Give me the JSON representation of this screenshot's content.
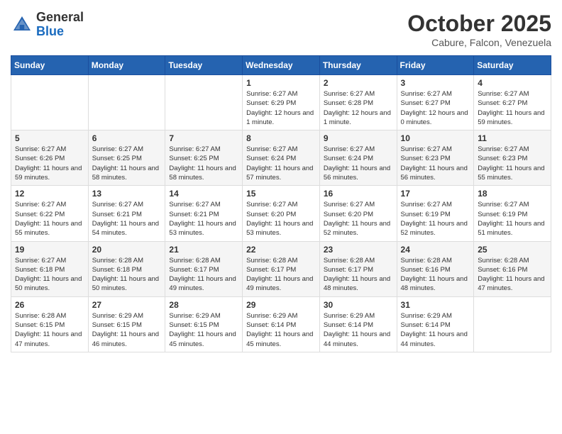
{
  "header": {
    "logo_general": "General",
    "logo_blue": "Blue",
    "month_title": "October 2025",
    "location": "Cabure, Falcon, Venezuela"
  },
  "days_of_week": [
    "Sunday",
    "Monday",
    "Tuesday",
    "Wednesday",
    "Thursday",
    "Friday",
    "Saturday"
  ],
  "weeks": [
    [
      {
        "day": "",
        "sunrise": "",
        "sunset": "",
        "daylight": ""
      },
      {
        "day": "",
        "sunrise": "",
        "sunset": "",
        "daylight": ""
      },
      {
        "day": "",
        "sunrise": "",
        "sunset": "",
        "daylight": ""
      },
      {
        "day": "1",
        "sunrise": "Sunrise: 6:27 AM",
        "sunset": "Sunset: 6:29 PM",
        "daylight": "Daylight: 12 hours and 1 minute."
      },
      {
        "day": "2",
        "sunrise": "Sunrise: 6:27 AM",
        "sunset": "Sunset: 6:28 PM",
        "daylight": "Daylight: 12 hours and 1 minute."
      },
      {
        "day": "3",
        "sunrise": "Sunrise: 6:27 AM",
        "sunset": "Sunset: 6:27 PM",
        "daylight": "Daylight: 12 hours and 0 minutes."
      },
      {
        "day": "4",
        "sunrise": "Sunrise: 6:27 AM",
        "sunset": "Sunset: 6:27 PM",
        "daylight": "Daylight: 11 hours and 59 minutes."
      }
    ],
    [
      {
        "day": "5",
        "sunrise": "Sunrise: 6:27 AM",
        "sunset": "Sunset: 6:26 PM",
        "daylight": "Daylight: 11 hours and 59 minutes."
      },
      {
        "day": "6",
        "sunrise": "Sunrise: 6:27 AM",
        "sunset": "Sunset: 6:25 PM",
        "daylight": "Daylight: 11 hours and 58 minutes."
      },
      {
        "day": "7",
        "sunrise": "Sunrise: 6:27 AM",
        "sunset": "Sunset: 6:25 PM",
        "daylight": "Daylight: 11 hours and 58 minutes."
      },
      {
        "day": "8",
        "sunrise": "Sunrise: 6:27 AM",
        "sunset": "Sunset: 6:24 PM",
        "daylight": "Daylight: 11 hours and 57 minutes."
      },
      {
        "day": "9",
        "sunrise": "Sunrise: 6:27 AM",
        "sunset": "Sunset: 6:24 PM",
        "daylight": "Daylight: 11 hours and 56 minutes."
      },
      {
        "day": "10",
        "sunrise": "Sunrise: 6:27 AM",
        "sunset": "Sunset: 6:23 PM",
        "daylight": "Daylight: 11 hours and 56 minutes."
      },
      {
        "day": "11",
        "sunrise": "Sunrise: 6:27 AM",
        "sunset": "Sunset: 6:23 PM",
        "daylight": "Daylight: 11 hours and 55 minutes."
      }
    ],
    [
      {
        "day": "12",
        "sunrise": "Sunrise: 6:27 AM",
        "sunset": "Sunset: 6:22 PM",
        "daylight": "Daylight: 11 hours and 55 minutes."
      },
      {
        "day": "13",
        "sunrise": "Sunrise: 6:27 AM",
        "sunset": "Sunset: 6:21 PM",
        "daylight": "Daylight: 11 hours and 54 minutes."
      },
      {
        "day": "14",
        "sunrise": "Sunrise: 6:27 AM",
        "sunset": "Sunset: 6:21 PM",
        "daylight": "Daylight: 11 hours and 53 minutes."
      },
      {
        "day": "15",
        "sunrise": "Sunrise: 6:27 AM",
        "sunset": "Sunset: 6:20 PM",
        "daylight": "Daylight: 11 hours and 53 minutes."
      },
      {
        "day": "16",
        "sunrise": "Sunrise: 6:27 AM",
        "sunset": "Sunset: 6:20 PM",
        "daylight": "Daylight: 11 hours and 52 minutes."
      },
      {
        "day": "17",
        "sunrise": "Sunrise: 6:27 AM",
        "sunset": "Sunset: 6:19 PM",
        "daylight": "Daylight: 11 hours and 52 minutes."
      },
      {
        "day": "18",
        "sunrise": "Sunrise: 6:27 AM",
        "sunset": "Sunset: 6:19 PM",
        "daylight": "Daylight: 11 hours and 51 minutes."
      }
    ],
    [
      {
        "day": "19",
        "sunrise": "Sunrise: 6:27 AM",
        "sunset": "Sunset: 6:18 PM",
        "daylight": "Daylight: 11 hours and 50 minutes."
      },
      {
        "day": "20",
        "sunrise": "Sunrise: 6:28 AM",
        "sunset": "Sunset: 6:18 PM",
        "daylight": "Daylight: 11 hours and 50 minutes."
      },
      {
        "day": "21",
        "sunrise": "Sunrise: 6:28 AM",
        "sunset": "Sunset: 6:17 PM",
        "daylight": "Daylight: 11 hours and 49 minutes."
      },
      {
        "day": "22",
        "sunrise": "Sunrise: 6:28 AM",
        "sunset": "Sunset: 6:17 PM",
        "daylight": "Daylight: 11 hours and 49 minutes."
      },
      {
        "day": "23",
        "sunrise": "Sunrise: 6:28 AM",
        "sunset": "Sunset: 6:17 PM",
        "daylight": "Daylight: 11 hours and 48 minutes."
      },
      {
        "day": "24",
        "sunrise": "Sunrise: 6:28 AM",
        "sunset": "Sunset: 6:16 PM",
        "daylight": "Daylight: 11 hours and 48 minutes."
      },
      {
        "day": "25",
        "sunrise": "Sunrise: 6:28 AM",
        "sunset": "Sunset: 6:16 PM",
        "daylight": "Daylight: 11 hours and 47 minutes."
      }
    ],
    [
      {
        "day": "26",
        "sunrise": "Sunrise: 6:28 AM",
        "sunset": "Sunset: 6:15 PM",
        "daylight": "Daylight: 11 hours and 47 minutes."
      },
      {
        "day": "27",
        "sunrise": "Sunrise: 6:29 AM",
        "sunset": "Sunset: 6:15 PM",
        "daylight": "Daylight: 11 hours and 46 minutes."
      },
      {
        "day": "28",
        "sunrise": "Sunrise: 6:29 AM",
        "sunset": "Sunset: 6:15 PM",
        "daylight": "Daylight: 11 hours and 45 minutes."
      },
      {
        "day": "29",
        "sunrise": "Sunrise: 6:29 AM",
        "sunset": "Sunset: 6:14 PM",
        "daylight": "Daylight: 11 hours and 45 minutes."
      },
      {
        "day": "30",
        "sunrise": "Sunrise: 6:29 AM",
        "sunset": "Sunset: 6:14 PM",
        "daylight": "Daylight: 11 hours and 44 minutes."
      },
      {
        "day": "31",
        "sunrise": "Sunrise: 6:29 AM",
        "sunset": "Sunset: 6:14 PM",
        "daylight": "Daylight: 11 hours and 44 minutes."
      },
      {
        "day": "",
        "sunrise": "",
        "sunset": "",
        "daylight": ""
      }
    ]
  ]
}
